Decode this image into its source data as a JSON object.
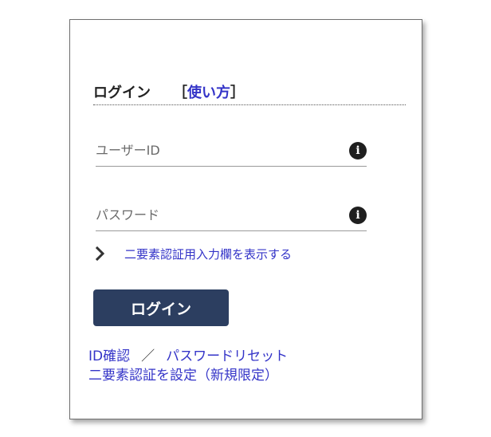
{
  "login_panel": {
    "heading": "ログイン",
    "howto_open_bracket": "［",
    "howto_link": "使い方",
    "howto_close_bracket": "］"
  },
  "fields": {
    "user_id": {
      "placeholder": "ユーザーID",
      "value": ""
    },
    "password": {
      "placeholder": "パスワード",
      "value": ""
    },
    "info_icon_glyph": "i"
  },
  "twofa_toggle": {
    "label": "二要素認証用入力欄を表示する"
  },
  "buttons": {
    "login": "ログイン"
  },
  "links": {
    "id_confirm": "ID確認",
    "separator": "／",
    "password_reset": "パスワードリセット",
    "twofa_setup": "二要素認証を設定（新規限定）"
  },
  "colors": {
    "link": "#3434c8",
    "button_bg": "#2c3e60",
    "icon_bg": "#1f1f1f"
  },
  "icons": {
    "info": "info-icon",
    "chevron": "chevron-right-icon"
  }
}
